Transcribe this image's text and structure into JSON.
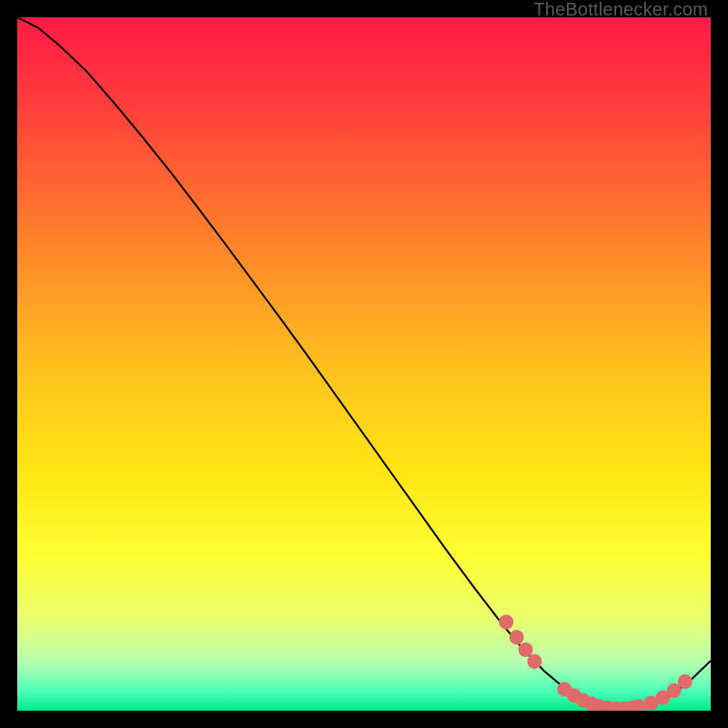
{
  "watermark": "TheBottlenecker.com",
  "chart_data": {
    "type": "line",
    "title": "",
    "xlabel": "",
    "ylabel": "",
    "xlim": [
      0,
      100
    ],
    "ylim": [
      0,
      100
    ],
    "grid": false,
    "legend": false,
    "background_gradient": {
      "stops": [
        {
          "offset": 0.0,
          "color": "#ff1a46"
        },
        {
          "offset": 0.12,
          "color": "#ff3c3c"
        },
        {
          "offset": 0.3,
          "color": "#ff7a2c"
        },
        {
          "offset": 0.5,
          "color": "#ffbf1e"
        },
        {
          "offset": 0.66,
          "color": "#ffe714"
        },
        {
          "offset": 0.78,
          "color": "#fdff33"
        },
        {
          "offset": 0.87,
          "color": "#e9ff70"
        },
        {
          "offset": 0.93,
          "color": "#b6ffb0"
        },
        {
          "offset": 0.973,
          "color": "#49ffb9"
        },
        {
          "offset": 1.0,
          "color": "#00e887"
        }
      ]
    },
    "series": [
      {
        "name": "curve",
        "color": "#000000",
        "stroke_width": 2,
        "x": [
          0,
          3,
          6,
          10,
          14,
          18,
          22,
          26,
          30,
          34,
          38,
          42,
          46,
          50,
          54,
          58,
          62,
          66,
          70,
          73,
          76,
          79,
          82,
          85,
          88,
          91,
          94,
          97,
          100
        ],
        "y": [
          100,
          98.5,
          96.0,
          92.2,
          87.6,
          82.8,
          77.8,
          72.6,
          67.3,
          61.9,
          56.5,
          51.0,
          45.4,
          39.8,
          34.2,
          28.6,
          23.0,
          17.6,
          12.4,
          8.8,
          5.7,
          3.2,
          1.4,
          0.5,
          0.3,
          0.7,
          2.0,
          4.3,
          7.2
        ]
      }
    ],
    "markers": {
      "name": "highlight-dots",
      "color": "#e06a6a",
      "radius": 8,
      "points": [
        {
          "x": 70.5,
          "y": 12.8
        },
        {
          "x": 72.0,
          "y": 10.6
        },
        {
          "x": 73.3,
          "y": 8.8
        },
        {
          "x": 74.6,
          "y": 7.1
        },
        {
          "x": 78.9,
          "y": 3.1
        },
        {
          "x": 80.3,
          "y": 2.2
        },
        {
          "x": 81.6,
          "y": 1.5
        },
        {
          "x": 82.8,
          "y": 1.0
        },
        {
          "x": 84.0,
          "y": 0.6
        },
        {
          "x": 85.2,
          "y": 0.4
        },
        {
          "x": 86.4,
          "y": 0.3
        },
        {
          "x": 87.5,
          "y": 0.3
        },
        {
          "x": 88.6,
          "y": 0.4
        },
        {
          "x": 89.6,
          "y": 0.6
        },
        {
          "x": 91.4,
          "y": 1.1
        },
        {
          "x": 93.1,
          "y": 1.9
        },
        {
          "x": 94.7,
          "y": 2.9
        },
        {
          "x": 96.3,
          "y": 4.2
        }
      ]
    }
  }
}
